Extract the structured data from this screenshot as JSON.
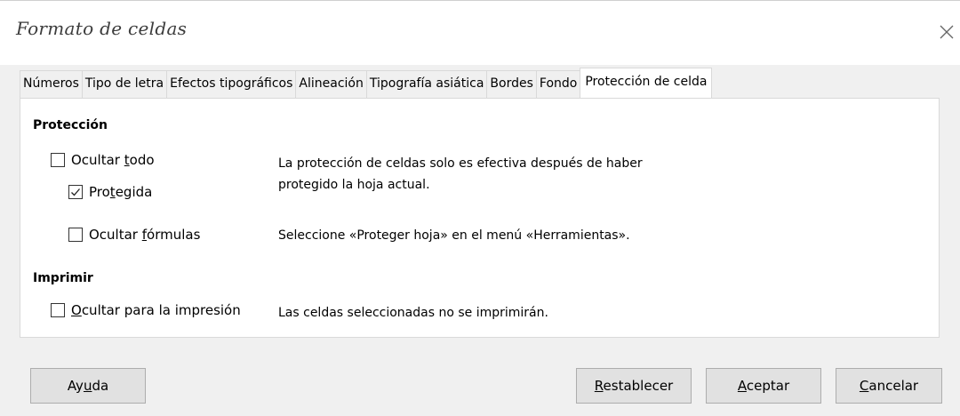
{
  "window": {
    "title": "Formato de celdas",
    "close_icon": "close-icon"
  },
  "tabs": [
    {
      "label": "Números"
    },
    {
      "label": "Tipo de letra"
    },
    {
      "label": "Efectos tipográficos"
    },
    {
      "label": "Alineación"
    },
    {
      "label": "Tipografía asiática"
    },
    {
      "label": "Bordes"
    },
    {
      "label": "Fondo"
    },
    {
      "label": "Protección de celda",
      "active": true
    }
  ],
  "protection": {
    "title": "Protección",
    "hide_all": {
      "pre": "Ocultar ",
      "key": "t",
      "post": "odo",
      "checked": false
    },
    "protected": {
      "pre": "Pro",
      "key": "t",
      "post": "egida",
      "checked": true
    },
    "hide_formulas": {
      "pre": "Ocultar ",
      "key": "f",
      "post": "órmulas",
      "checked": false
    },
    "desc_line1": "La protección de celdas solo es efectiva después de haber",
    "desc_line2": "protegido la hoja actual.",
    "desc_line3": "Seleccione «Proteger hoja» en el menú «Herramientas»."
  },
  "print": {
    "title": "Imprimir",
    "hide_print": {
      "pre": "",
      "key": "O",
      "post": "cultar para la impresión",
      "checked": false
    },
    "desc": "Las celdas seleccionadas no se imprimirán."
  },
  "buttons": {
    "help": {
      "pre": "Ay",
      "key": "u",
      "post": "da"
    },
    "reset": {
      "pre": "",
      "key": "R",
      "post": "establecer"
    },
    "ok": {
      "pre": "",
      "key": "A",
      "post": "ceptar"
    },
    "cancel": {
      "pre": "",
      "key": "C",
      "post": "ancelar"
    }
  },
  "colors": {
    "dialog_bg": "#f0f0f0",
    "panel_bg": "#ffffff",
    "button_bg": "#e1e1e1",
    "border": "#d9d9d9"
  }
}
